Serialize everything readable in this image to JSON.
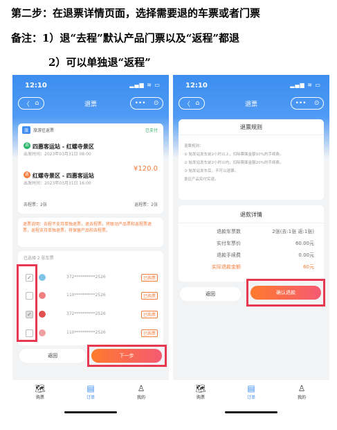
{
  "instructions": {
    "line1": "第二步：在退票详情页面，选择需要退的车票或者门票",
    "line2": "备注：1）退“去程”默认产品门票以及“返程”都退",
    "line3": "2）可以单独退“返程”"
  },
  "status_bar": {
    "time": "12:10",
    "icons": "▂▄▆ ≋ ▭"
  },
  "nav": {
    "title": "退票",
    "back_glyph": "〈",
    "home_glyph": "⌂",
    "more_glyph": "•••",
    "target_glyph": "⊙"
  },
  "left": {
    "order": {
      "tag": "旅",
      "title": "旅游往返票",
      "status": "已支付",
      "outbound_badge": "去",
      "outbound_route": "四惠客运站 - 红螺寺景区",
      "outbound_time": "出发时间：2023年03月31日 08:00",
      "return_badge": "返",
      "return_route": "红螺寺景区 - 四惠客运站",
      "return_time": "出发时间：2023年03月31日 16:00",
      "price": "¥120.0",
      "outbound_count": "去程票：2张",
      "return_count": "返程票：2张"
    },
    "notice": "退票说明：去程不支持单独退票，退去程票，将联动产品票和返程票退票，返程支持单独退票，将保留产品和去程票。",
    "selected_label": "已选择 2 张车票",
    "tickets": [
      {
        "id": "372**********2526",
        "status": "已购票",
        "checked": true
      },
      {
        "id": "110**********2526",
        "status": "已购票",
        "checked": false
      },
      {
        "id": "372**********2526",
        "status": "已购票",
        "checked": true
      },
      {
        "id": "110**********2526",
        "status": "已购票",
        "checked": false
      }
    ],
    "back_button": "返回",
    "next_button": "下一步"
  },
  "right": {
    "rules_title": "退票规则",
    "rules": [
      "退票规则：",
      "① 始发站发车前2小时以上，扣除票面金额10%的手续费。",
      "② 始发站发车前2小时以内，扣除票面金额20%的手续费。",
      "③ 始发站发车后，不可以退票。",
      "景区产品实付实退。"
    ],
    "detail_title": "退款详情",
    "details": [
      {
        "label": "退款车票数",
        "value": "2张(去:1张 返:1张)"
      },
      {
        "label": "实付车票价",
        "value": "60.00元"
      },
      {
        "label": "退款手续费",
        "value": "0.00元"
      },
      {
        "label": "实际退款金额",
        "value": "60元"
      }
    ],
    "back_button": "返回",
    "confirm_button": "确认退款"
  },
  "tabbar": [
    {
      "label": "购票",
      "icon": "🗺"
    },
    {
      "label": "订单",
      "icon": "▤"
    },
    {
      "label": "我的",
      "icon": "♙"
    }
  ],
  "colors": {
    "primary": "#3d8ef0",
    "accent_orange": "#f47b3a",
    "highlight_red": "#e8384f",
    "paid_green": "#2bb46b"
  }
}
